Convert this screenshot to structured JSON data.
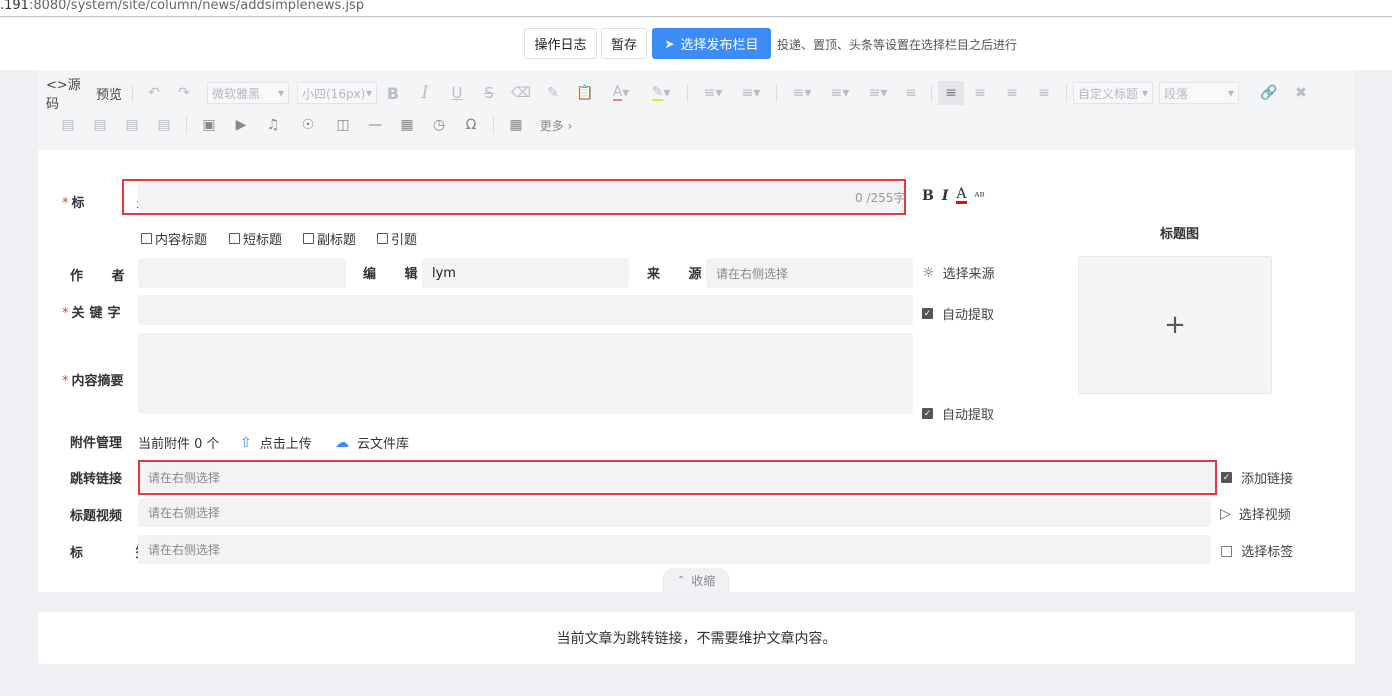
{
  "browser": {
    "url_host": ".191",
    "url_path": ":8080/system/site/column/news/addsimplenews.jsp"
  },
  "topbar": {
    "log_button": "操作日志",
    "save_button": "暂存",
    "publish_button": "选择发布栏目",
    "hint": "投递、置顶、头条等设置在选择栏目之后进行"
  },
  "toolbar": {
    "source": "<>源码",
    "preview": "预览",
    "font_family": "微软雅黑",
    "font_size": "小四(16px)",
    "custom_title": "自定义标题",
    "paragraph": "段落",
    "more": "更多 ›"
  },
  "form": {
    "title_label": "标 题",
    "title_counter": "0 /255字",
    "title_fmt": {
      "bold": "B",
      "italic": "I",
      "color": "A",
      "spell": "ᴬᴮ"
    },
    "checkboxes": [
      "内容标题",
      "短标题",
      "副标题",
      "引题"
    ],
    "author_label": "作 者",
    "editor_label": "编 辑",
    "editor_value": "lym",
    "source_label": "来 源",
    "source_placeholder": "请在右侧选择",
    "source_link": "选择来源",
    "keyword_label": "关键字",
    "keyword_auto": "自动提取",
    "summary_label": "内容摘要",
    "summary_auto": "自动提取",
    "attach_label": "附件管理",
    "attach_count": "当前附件 0 个",
    "upload_link": "点击上传",
    "cloud_link": "云文件库",
    "jump_label": "跳转链接",
    "jump_placeholder": "请在右侧选择",
    "jump_add": "添加链接",
    "video_label": "标题视频",
    "video_placeholder": "请在右侧选择",
    "video_link": "选择视频",
    "tag_label": "标 签",
    "tag_placeholder": "请在右侧选择",
    "tag_link": "选择标签",
    "title_image_label": "标题图",
    "title_image_add": "+",
    "collapse": "收缩"
  },
  "notice": "当前文章为跳转链接，不需要维护文章内容。",
  "colors": {
    "primary": "#3d8cf5",
    "required": "#e4431e",
    "highlight_border": "#e23a3a"
  }
}
